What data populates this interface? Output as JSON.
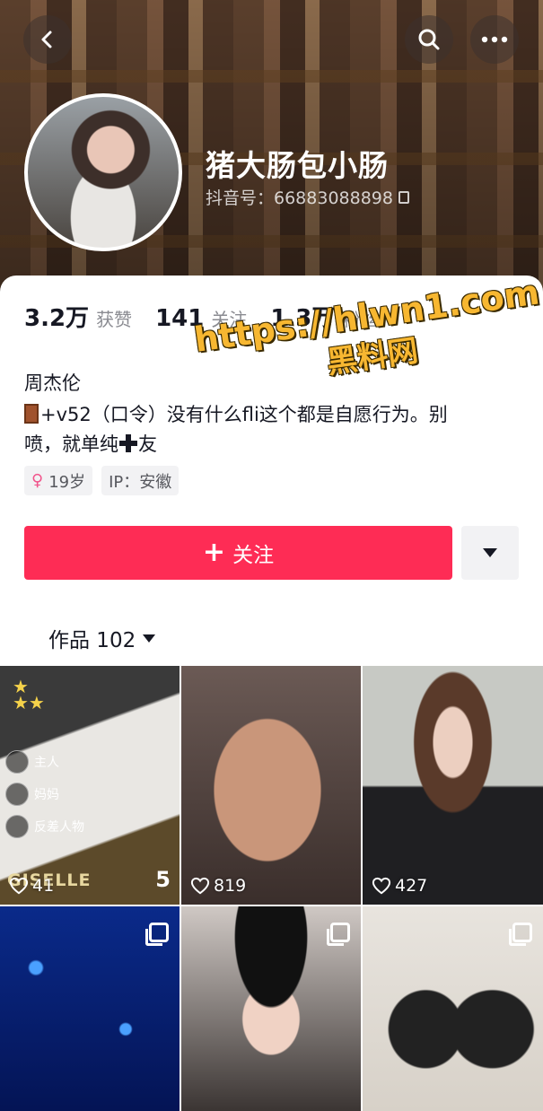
{
  "header": {
    "nickname": "猪大肠包小肠",
    "douyin_id": "抖音号：66883088898"
  },
  "stats": [
    {
      "num": "3.2万",
      "label": "获赞"
    },
    {
      "num": "141",
      "label": "关注"
    },
    {
      "num": "1.3万",
      "label": "粉丝"
    }
  ],
  "watermark": {
    "line1": "https://hlwn1.com",
    "line2": "黑料网"
  },
  "bio": {
    "title": "周杰伦",
    "line1": "+v52（口令）没有什么fli这个都是自愿行为。别",
    "line2": "喷，就单纯",
    "line2_end": "友"
  },
  "tags": {
    "age": "19岁",
    "ip": "IP：安徽"
  },
  "actions": {
    "follow_label": "关注"
  },
  "works": {
    "tab_label": "作品 102"
  },
  "grid": [
    {
      "likes": "41",
      "overlay_name": "GISELLE",
      "score": "5",
      "labels": [
        "主人",
        "妈妈",
        "反差人物"
      ]
    },
    {
      "likes": "819"
    },
    {
      "likes": "427"
    },
    {
      "likes": ""
    },
    {
      "likes": ""
    },
    {
      "likes": ""
    }
  ],
  "colors": {
    "accent": "#fe2c55",
    "watermark": "#f7b731"
  }
}
